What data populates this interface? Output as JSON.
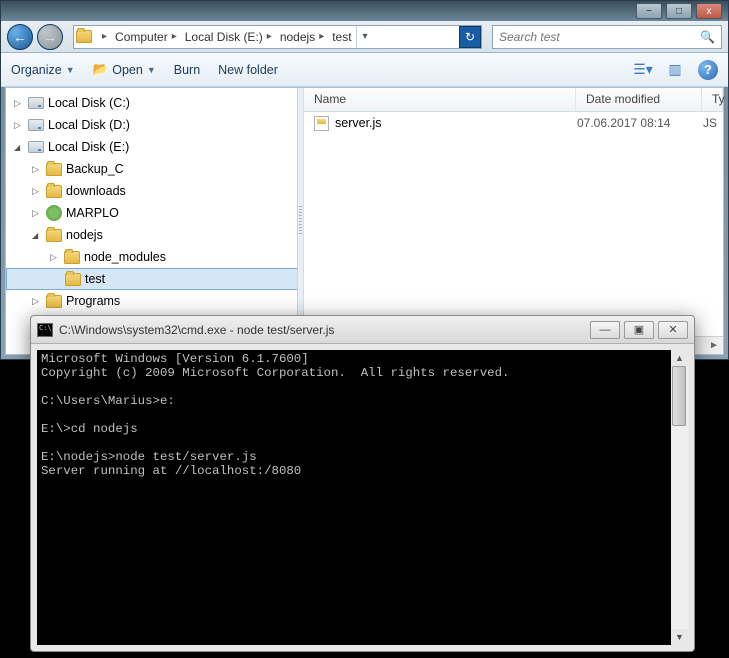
{
  "parent_window": {
    "controls": {
      "min": "−",
      "max": "□",
      "close": "x"
    }
  },
  "nav": {
    "back_glyph": "←",
    "fwd_glyph": "→",
    "refresh_glyph": "↻",
    "dropdown_glyph": "▾"
  },
  "breadcrumbs": [
    {
      "label": "Computer"
    },
    {
      "label": "Local Disk (E:)"
    },
    {
      "label": "nodejs"
    },
    {
      "label": "test"
    }
  ],
  "search": {
    "placeholder": "Search test"
  },
  "toolbar": {
    "organize": "Organize",
    "open": "Open",
    "burn": "Burn",
    "new_folder": "New folder"
  },
  "tree": [
    {
      "label": "Local Disk (C:)",
      "icon": "drive",
      "state": "exp",
      "indent": 0
    },
    {
      "label": "Local Disk (D:)",
      "icon": "drive",
      "state": "exp",
      "indent": 0
    },
    {
      "label": "Local Disk (E:)",
      "icon": "drive",
      "state": "open",
      "indent": 0
    },
    {
      "label": "Backup_C",
      "icon": "folder",
      "state": "exp",
      "indent": 1
    },
    {
      "label": "downloads",
      "icon": "folder",
      "state": "exp",
      "indent": 1
    },
    {
      "label": "MARPLO",
      "icon": "marplo",
      "state": "exp",
      "indent": 1
    },
    {
      "label": "nodejs",
      "icon": "folder",
      "state": "open",
      "indent": 1
    },
    {
      "label": "node_modules",
      "icon": "folder",
      "state": "exp",
      "indent": 2
    },
    {
      "label": "test",
      "icon": "folder",
      "state": "leaf",
      "indent": 2,
      "selected": true
    },
    {
      "label": "Programs",
      "icon": "folder",
      "state": "exp",
      "indent": 1
    }
  ],
  "columns": {
    "name": "Name",
    "date": "Date modified",
    "type": "Ty"
  },
  "files": [
    {
      "name": "server.js",
      "date": "07.06.2017 08:14",
      "type": "JS"
    }
  ],
  "cmd": {
    "title": "C:\\Windows\\system32\\cmd.exe - node  test/server.js",
    "controls": {
      "min": "—",
      "max": "▣",
      "close": "✕"
    },
    "lines": "Microsoft Windows [Version 6.1.7600]\nCopyright (c) 2009 Microsoft Corporation.  All rights reserved.\n\nC:\\Users\\Marius>e:\n\nE:\\>cd nodejs\n\nE:\\nodejs>node test/server.js\nServer running at //localhost:/8080\n"
  }
}
